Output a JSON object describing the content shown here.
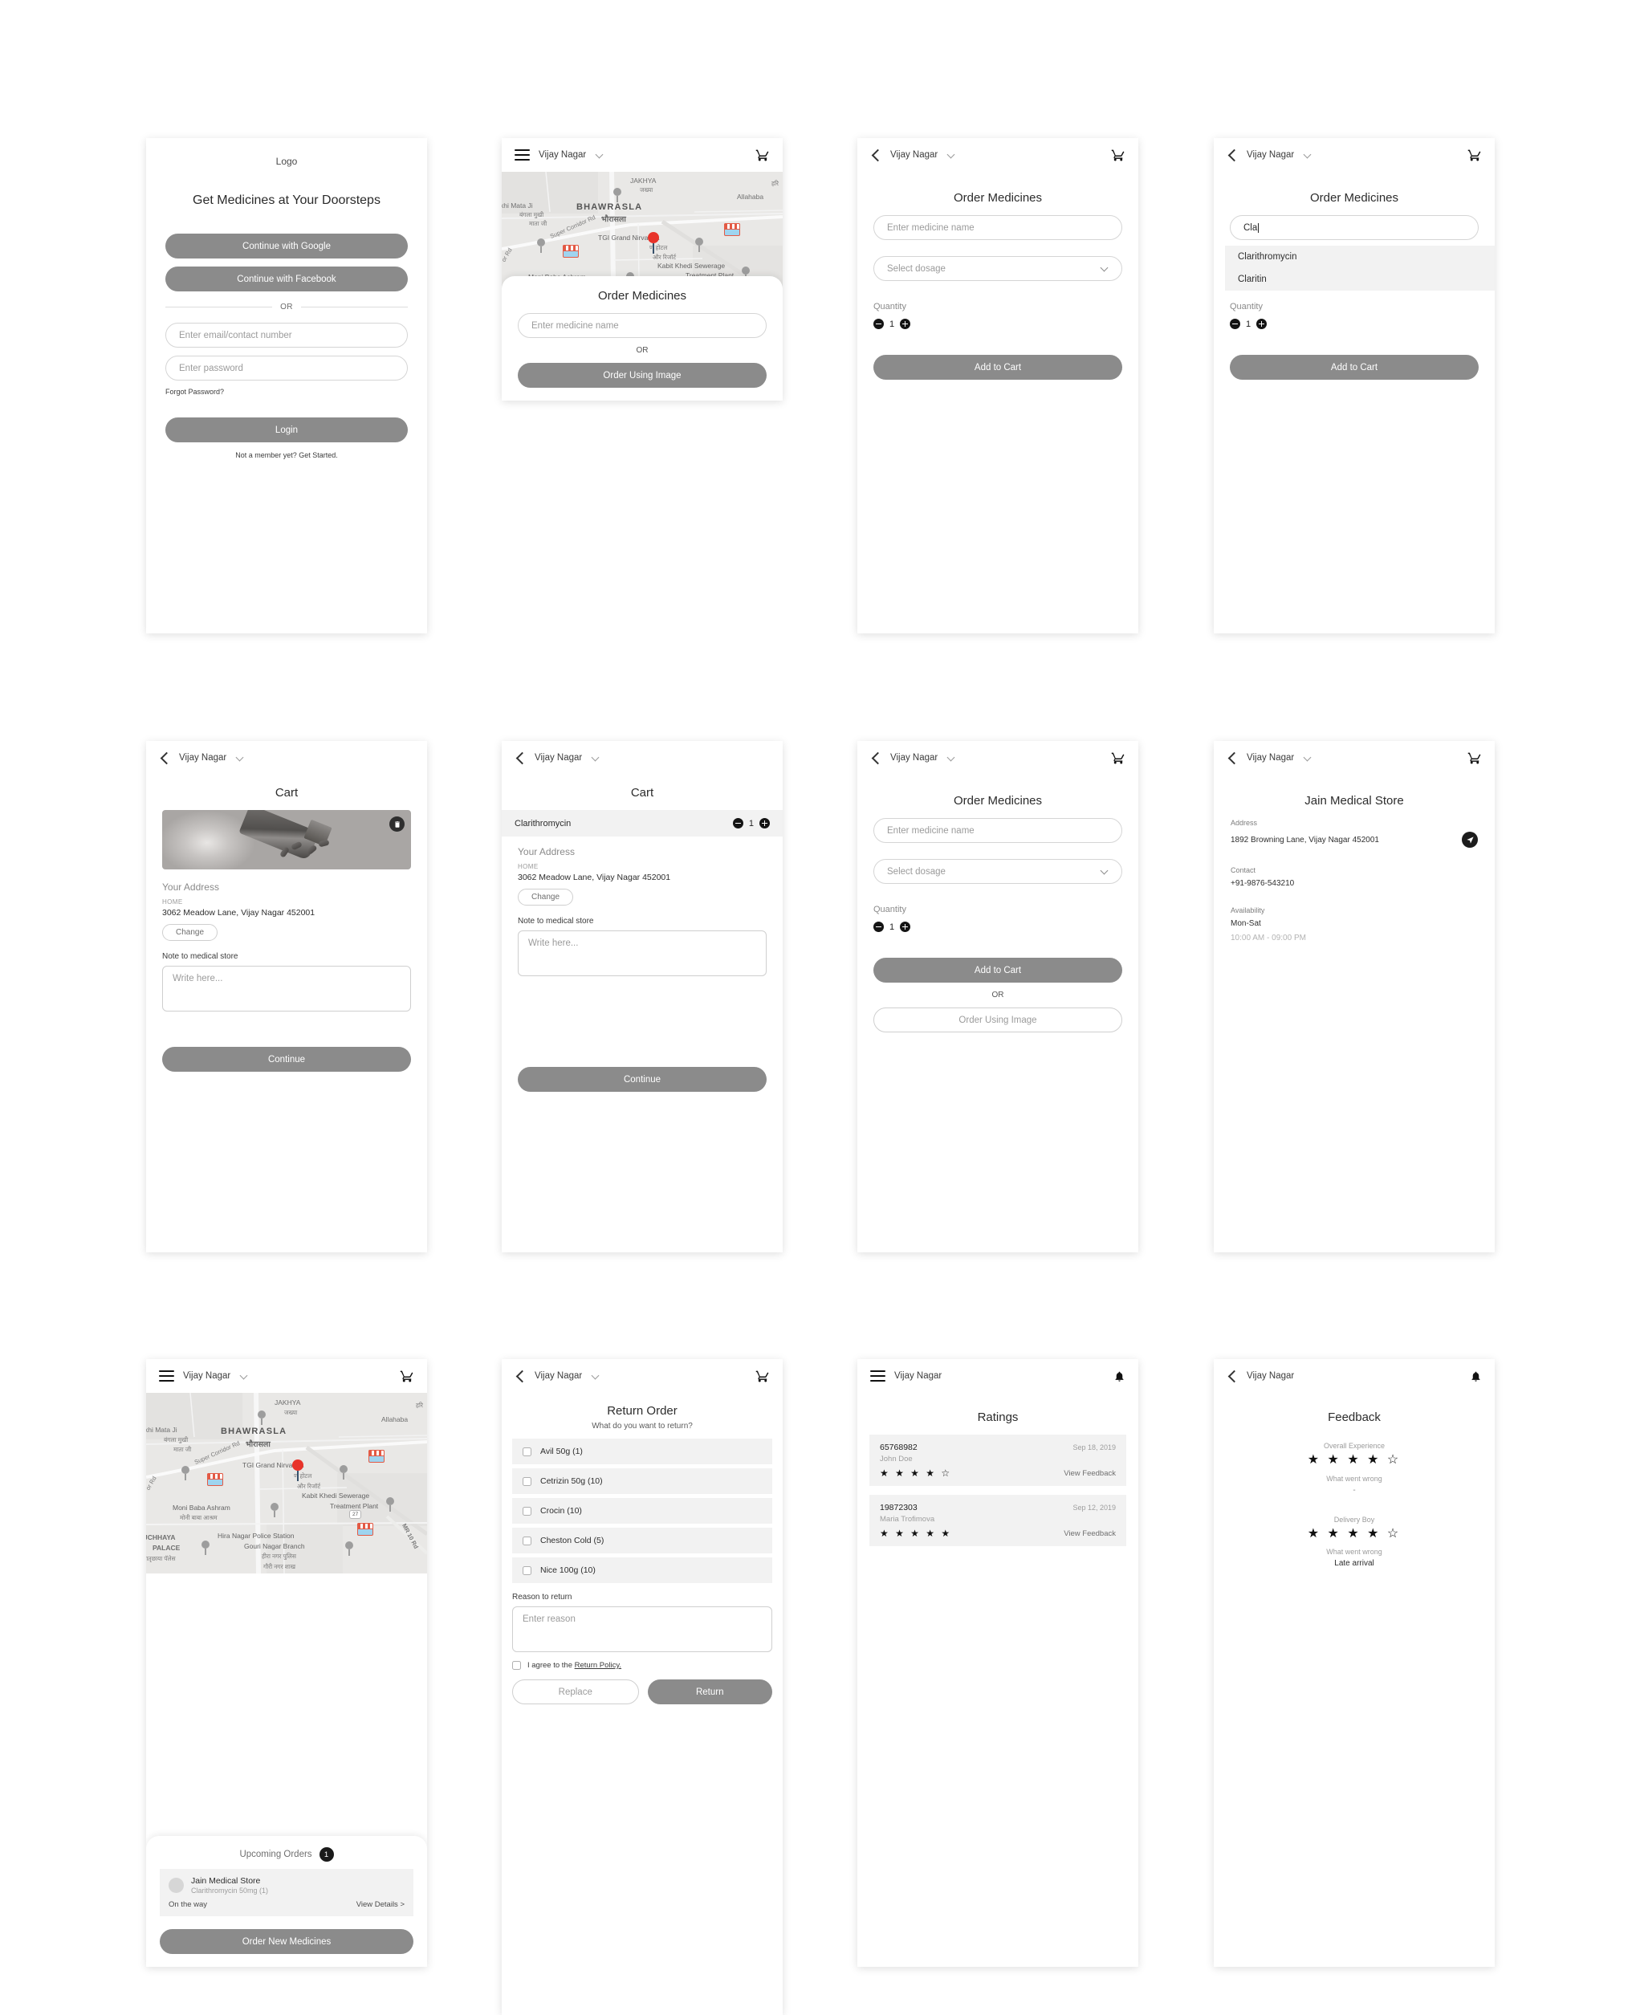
{
  "common": {
    "city": "Vijay Nagar",
    "icons": {
      "menu": "hamburger-icon",
      "back": "back-chevron-icon",
      "cart": "shopping-cart-icon",
      "bell": "notification-bell-icon",
      "caret": "chevron-down-icon"
    }
  },
  "screen_login": {
    "logo": "Logo",
    "headline": "Get Medicines at Your Doorsteps",
    "google_button": "Continue with Google",
    "facebook_button": "Continue with Facebook",
    "or": "OR",
    "email_placeholder": "Enter email/contact number",
    "password_placeholder": "Enter password",
    "forgot": "Forgot Password?",
    "login_button": "Login",
    "signup": "Not a member yet? Get Started."
  },
  "map": {
    "labels": {
      "jakhya_en": "JAKHYA",
      "jakhya_hi": "जख्या",
      "allahabad": "Allahaba",
      "bhawrasla_en": "BHAWRASLA",
      "bhawrasla_hi": "भौरासला",
      "mata_en": "khi Mata Ji",
      "mata_hi1": "बंगला मुखी",
      "mata_hi2": "माता जी",
      "corridor": "Super Corridor Rd",
      "tgi": "TGI Grand Nirvanaa",
      "tgi_hi1": "ण होटल",
      "tgi_hi2": "और रिजॉर्ट",
      "kabit1": "Kabit Khedi Sewerage",
      "kabit2": "Treatment Plant",
      "moni_en": "Moni Baba Ashram",
      "moni_hi": "मोनी बाबा आश्रम",
      "hira1": "Hira Nagar Police Station",
      "hira2": "Gouri Nagar Branch",
      "hira_hi1": "हीरा नगर पुलिस",
      "hira_hi2": "गौरी नगर शाख",
      "palace1": "JCHHAYA",
      "palace2": "PALACE",
      "palace_hi": "मातृछाया पॅलेस",
      "mr10": "MR 10 Rd",
      "or_rd": "or Rd",
      "hi_edge": "हरि",
      "shield27": "27"
    }
  },
  "screen_map_order": {
    "sheet_title": "Order Medicines",
    "medicine_placeholder": "Enter medicine name",
    "or": "OR",
    "image_button": "Order Using Image"
  },
  "screen_order": {
    "title": "Order Medicines",
    "medicine_placeholder": "Enter medicine name",
    "dosage_placeholder": "Select dosage",
    "quantity_label": "Quantity",
    "quantity_value": "1",
    "add_to_cart": "Add to Cart"
  },
  "screen_order_suggest": {
    "title": "Order Medicines",
    "medicine_value": "Cla",
    "suggestions": [
      "Clarithromycin",
      "Claritin"
    ],
    "quantity_label": "Quantity",
    "quantity_value": "1",
    "add_to_cart": "Add to Cart"
  },
  "screen_order_image": {
    "title": "Order Medicines",
    "medicine_placeholder": "Enter medicine name",
    "dosage_placeholder": "Select dosage",
    "quantity_label": "Quantity",
    "quantity_value": "1",
    "add_to_cart": "Add to Cart",
    "or": "OR",
    "image_button": "Order Using Image"
  },
  "screen_cart_image": {
    "title": "Cart",
    "address_label": "Your Address",
    "address_tag": "HOME",
    "address_value": "3062 Meadow Lane, Vijay Nagar 452001",
    "change_button": "Change",
    "note_label": "Note to medical store",
    "note_placeholder": "Write here...",
    "continue_button": "Continue"
  },
  "screen_cart_item": {
    "title": "Cart",
    "item_name": "Clarithromycin",
    "item_qty": "1",
    "address_label": "Your Address",
    "address_tag": "HOME",
    "address_value": "3062 Meadow Lane, Vijay Nagar 452001",
    "change_button": "Change",
    "note_label": "Note to medical store",
    "note_placeholder": "Write here...",
    "continue_button": "Continue"
  },
  "screen_store": {
    "title": "Jain Medical Store",
    "address_label": "Address",
    "address_value": "1892 Browning Lane, Vijay Nagar 452001",
    "contact_label": "Contact",
    "contact_value": "+91-9876-543210",
    "availability_label": "Availability",
    "availability_days": "Mon-Sat",
    "availability_hours": "10:00 AM - 09:00 PM"
  },
  "screen_upcoming": {
    "section_title": "Upcoming Orders",
    "badge_count": "1",
    "order_store": "Jain Medical Store",
    "order_medicine": "Clarithromycin 50mg (1)",
    "order_status": "On the way",
    "view_details": "View Details  >",
    "order_new_button": "Order New Medicines"
  },
  "screen_return": {
    "title": "Return Order",
    "subtitle": "What do you want to return?",
    "items": [
      "Avil 50g (1)",
      "Cetrizin 50g (10)",
      "Crocin (10)",
      "Cheston Cold (5)",
      "Nice 100g (10)"
    ],
    "reason_label": "Reason to return",
    "reason_placeholder": "Enter reason",
    "agree_prefix": "I agree to the ",
    "agree_link": "Return Policy.",
    "replace_button": "Replace",
    "return_button": "Return"
  },
  "screen_ratings": {
    "title": "Ratings",
    "rows": [
      {
        "id": "65768982",
        "date": "Sep 18, 2019",
        "user": "John Doe",
        "stars": "★ ★ ★ ★ ☆",
        "rating": 4,
        "link": "View Feedback"
      },
      {
        "id": "19872303",
        "date": "Sep 12, 2019",
        "user": "Maria Trofimova",
        "stars": "★ ★ ★ ★ ★",
        "rating": 5,
        "link": "View Feedback"
      }
    ]
  },
  "screen_feedback": {
    "title": "Feedback",
    "overall_label": "Overall Experience",
    "overall_stars": "★ ★ ★ ★ ☆",
    "overall_rating": 4,
    "overall_wrong_label": "What went wrong",
    "overall_wrong_value": "-",
    "delivery_label": "Delivery Boy",
    "delivery_stars": "★ ★ ★ ★ ☆",
    "delivery_rating": 4,
    "delivery_wrong_label": "What went wrong",
    "delivery_wrong_value": "Late arrival"
  }
}
